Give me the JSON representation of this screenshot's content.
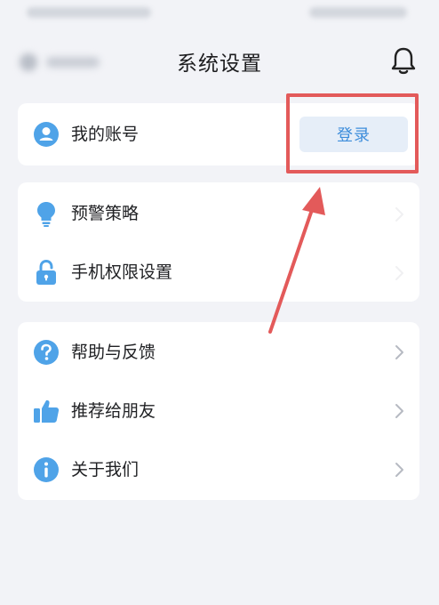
{
  "header": {
    "title": "系统设置"
  },
  "account": {
    "label": "我的账号",
    "login_label": "登录"
  },
  "group1": [
    {
      "label": "预警策略",
      "icon": "bulb-icon"
    },
    {
      "label": "手机权限设置",
      "icon": "lock-icon"
    }
  ],
  "group2": [
    {
      "label": "帮助与反馈",
      "icon": "help-icon"
    },
    {
      "label": "推荐给朋友",
      "icon": "thumbs-up-icon"
    },
    {
      "label": "关于我们",
      "icon": "info-icon"
    }
  ],
  "colors": {
    "accent": "#3d8ddb",
    "icon_blue": "#4fa3e8",
    "annotation_red": "#e35a5a",
    "background": "#f2f3f7"
  }
}
